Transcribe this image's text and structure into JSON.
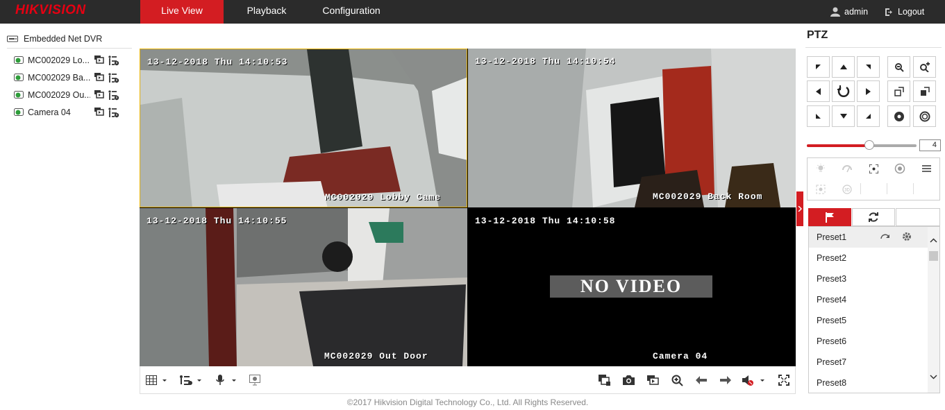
{
  "header": {
    "logo": "HIKVISION",
    "tabs": [
      "Live View",
      "Playback",
      "Configuration"
    ],
    "active_tab": "Live View",
    "user": "admin",
    "logout": "Logout"
  },
  "tree": {
    "root": "Embedded Net DVR",
    "cameras": [
      "MC002029 Lo...",
      "MC002029 Ba...",
      "MC002029 Ou...",
      "Camera 04"
    ]
  },
  "tiles": [
    {
      "timestamp": "13-12-2018 Thu 14:10:53",
      "name": "MC002029 Lobby Came"
    },
    {
      "timestamp": "13-12-2018 Thu 14:10:54",
      "name": "MC002029 Back Room"
    },
    {
      "timestamp": "13-12-2018 Thu 14:10:55",
      "name": "MC002029 Out Door"
    },
    {
      "timestamp": "13-12-2018 Thu 14:10:58",
      "name": "Camera 04",
      "no_video": "NO VIDEO"
    }
  ],
  "ptz": {
    "title": "PTZ",
    "speed": "4",
    "speed_fraction": 0.57,
    "presets": [
      "Preset1",
      "Preset2",
      "Preset3",
      "Preset4",
      "Preset5",
      "Preset6",
      "Preset7",
      "Preset8"
    ]
  },
  "footer": "©2017 Hikvision Digital Technology Co., Ltd. All Rights Reserved.",
  "colors": {
    "accent": "#d31d22",
    "header": "#2b2b2b",
    "selected_border": "#e8b200"
  }
}
